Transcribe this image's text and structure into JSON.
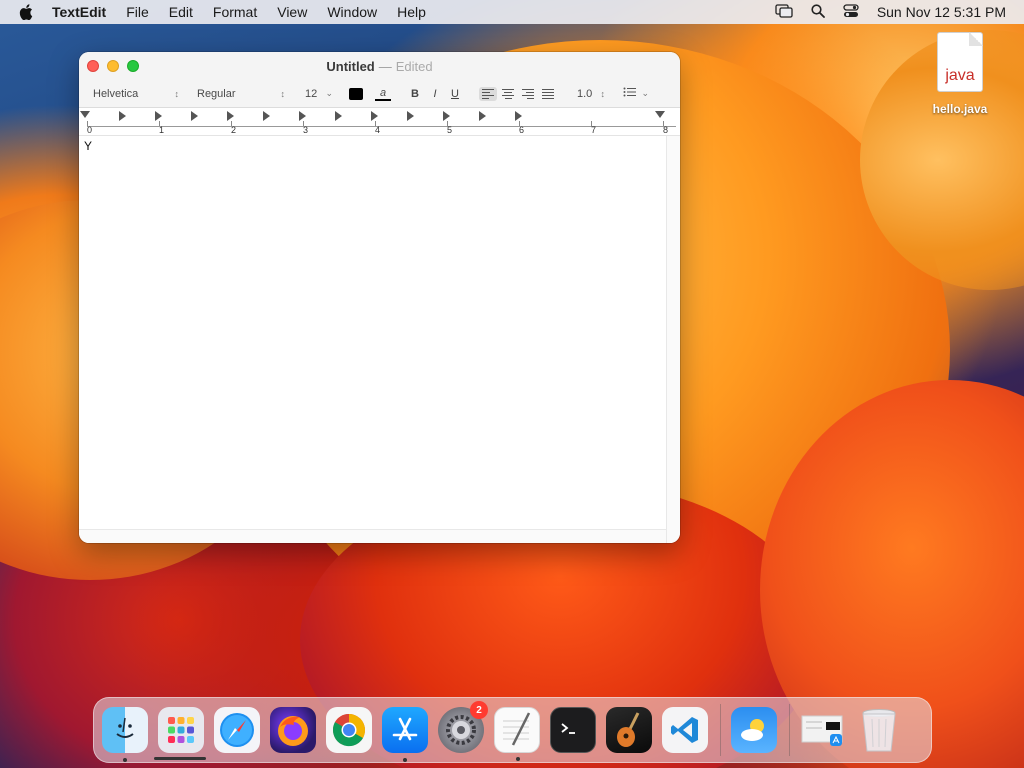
{
  "menubar": {
    "app_name": "TextEdit",
    "menus": [
      "File",
      "Edit",
      "Format",
      "View",
      "Window",
      "Help"
    ],
    "clock": "Sun Nov 12  5:31 PM",
    "icons": [
      "screen-mirroring-icon",
      "spotlight-search-icon",
      "control-center-icon"
    ]
  },
  "desktop": {
    "file": {
      "extension": "java",
      "label": "hello.java"
    }
  },
  "window": {
    "title": "Untitled",
    "title_separator": "—",
    "title_status": "Edited",
    "toolbar": {
      "font_family": "Helvetica",
      "font_style": "Regular",
      "font_size": "12",
      "text_color": "#000000",
      "bg_color_label": "a",
      "bold_label": "B",
      "italic_label": "I",
      "underline_label": "U",
      "line_spacing": "1.0"
    },
    "ruler": {
      "numbers": [
        "0",
        "1",
        "2",
        "3",
        "4",
        "5",
        "6",
        "7",
        "8"
      ]
    },
    "document_text": "Y"
  },
  "dock": {
    "apps": [
      {
        "name": "Finder",
        "icon": "finder-icon",
        "running": true
      },
      {
        "name": "Launchpad",
        "icon": "launchpad-icon",
        "running": false
      },
      {
        "name": "Safari",
        "icon": "safari-icon",
        "running": false
      },
      {
        "name": "Firefox",
        "icon": "firefox-icon",
        "running": false
      },
      {
        "name": "Chrome",
        "icon": "chrome-icon",
        "running": false
      },
      {
        "name": "App Store",
        "icon": "app-store-icon",
        "running": true
      },
      {
        "name": "System Settings",
        "icon": "system-settings-icon",
        "running": false,
        "badge": "2"
      },
      {
        "name": "TextEdit",
        "icon": "textedit-icon",
        "running": true
      },
      {
        "name": "Terminal",
        "icon": "terminal-icon",
        "running": false
      },
      {
        "name": "GarageBand",
        "icon": "garageband-icon",
        "running": false
      },
      {
        "name": "Visual Studio Code",
        "icon": "vscode-icon",
        "running": false
      },
      {
        "name": "Weather",
        "icon": "weather-icon",
        "running": false
      },
      {
        "name": "Downloads",
        "icon": "downloads-stack-icon",
        "running": false
      },
      {
        "name": "Trash",
        "icon": "trash-icon",
        "running": false
      }
    ]
  }
}
